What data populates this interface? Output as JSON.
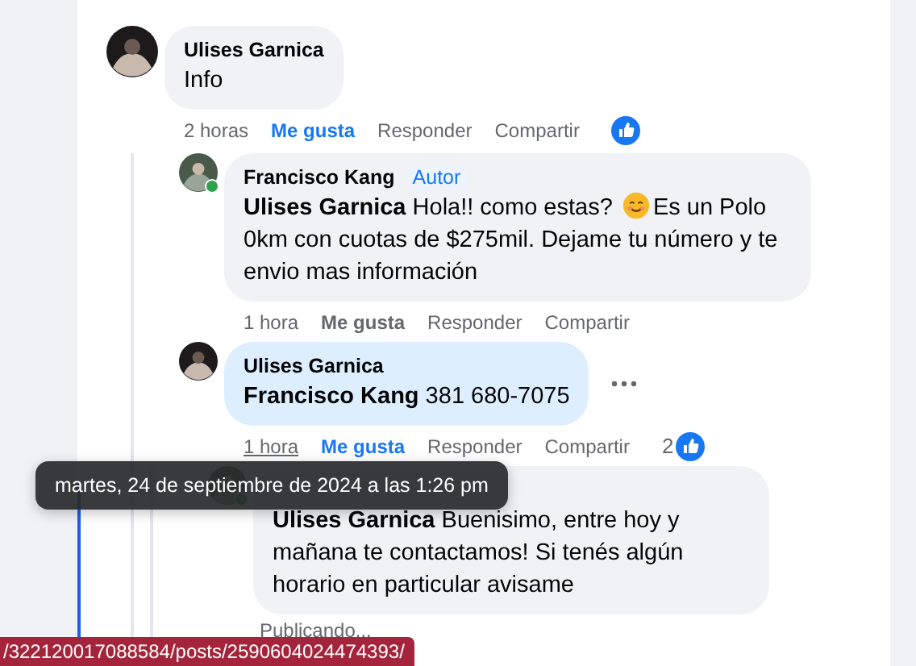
{
  "comments": [
    {
      "author": "Ulises Garnica",
      "text": "Info",
      "time": "2 horas",
      "time_hovered": false,
      "reacted": true,
      "actions": [
        "Me gusta",
        "Responder",
        "Compartir"
      ],
      "like_selected": true,
      "children": [
        {
          "author": "Francisco Kang",
          "author_badge": "Autor",
          "text": "**Ulises Garnica** Hola!! como estas?",
          "text_after_emoji": "Es un Polo 0km con cuotas de $275mil. Dejame tu número y te envio mas información",
          "time": "1 hora",
          "time_hovered": false,
          "highlighted": false,
          "online": true,
          "actions": [
            "Me gusta",
            "Responder",
            "Compartir"
          ],
          "like_selected": false
        },
        {
          "author": "Ulises Garnica",
          "text": "**Francisco Kang** 381 680-7075",
          "time": "1 hora",
          "time_hovered": true,
          "highlighted": true,
          "reacted": true,
          "reaction_count": "2",
          "show_more": true,
          "actions": [
            "Me gusta",
            "Responder",
            "Compartir"
          ],
          "like_selected": true,
          "children": [
            {
              "text": "**Ulises Garnica** Buenisimo, entre hoy y mañana te contactamos! Si tenés algún horario en particular avisame",
              "status": "Publicando...",
              "online": true
            }
          ]
        }
      ]
    }
  ],
  "tooltip": "martes, 24 de septiembre de 2024 a las 1:26 pm",
  "status_bar": "/322120017088584/posts/2590604024474393/"
}
